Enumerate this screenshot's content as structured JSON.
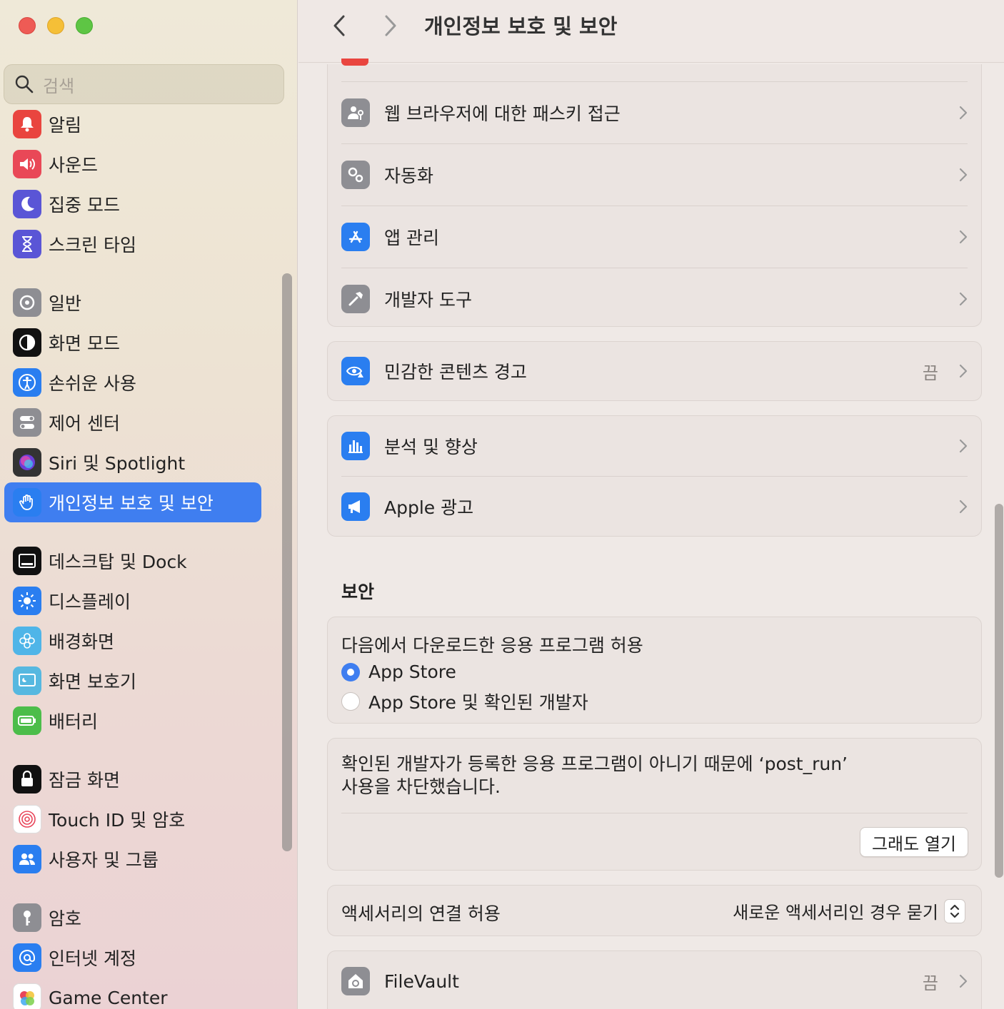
{
  "window": {
    "title": "개인정보 보호 및 보안"
  },
  "search": {
    "placeholder": "검색"
  },
  "sidebar": {
    "items": [
      {
        "label": "알림",
        "icon": "bell-icon",
        "color": "#e9453f"
      },
      {
        "label": "사운드",
        "icon": "speaker-icon",
        "color": "#e94857"
      },
      {
        "label": "집중 모드",
        "icon": "moon-icon",
        "color": "#5a55d6"
      },
      {
        "label": "스크린 타임",
        "icon": "hourglass-icon",
        "color": "#5a55d6"
      },
      {
        "label": "일반",
        "icon": "gear-icon",
        "color": "#8e8e93"
      },
      {
        "label": "화면 모드",
        "icon": "appearance-icon",
        "color": "#111111"
      },
      {
        "label": "손쉬운 사용",
        "icon": "accessibility-icon",
        "color": "#2a7ef0"
      },
      {
        "label": "제어 센터",
        "icon": "control-center-icon",
        "color": "#8e8e93"
      },
      {
        "label": "Siri 및 Spotlight",
        "icon": "siri-icon",
        "color": "#333333"
      },
      {
        "label": "개인정보 보호 및 보안",
        "icon": "hand-icon",
        "color": "#2a7ef0"
      },
      {
        "label": "데스크탑 및 Dock",
        "icon": "dock-icon",
        "color": "#111111"
      },
      {
        "label": "디스플레이",
        "icon": "sun-icon",
        "color": "#2a7ef0"
      },
      {
        "label": "배경화면",
        "icon": "flower-icon",
        "color": "#4fb5e8"
      },
      {
        "label": "화면 보호기",
        "icon": "screensaver-icon",
        "color": "#56b8e0"
      },
      {
        "label": "배터리",
        "icon": "battery-icon",
        "color": "#4cbd4a"
      },
      {
        "label": "잠금 화면",
        "icon": "lock-icon",
        "color": "#111111"
      },
      {
        "label": "Touch ID 및 암호",
        "icon": "fingerprint-icon",
        "color": "#ffffff"
      },
      {
        "label": "사용자 및 그룹",
        "icon": "users-icon",
        "color": "#2a7ef0"
      },
      {
        "label": "암호",
        "icon": "key-icon",
        "color": "#8e8e93"
      },
      {
        "label": "인터넷 계정",
        "icon": "at-icon",
        "color": "#2a7ef0"
      },
      {
        "label": "Game Center",
        "icon": "game-center-icon",
        "color": "#ffffff"
      }
    ],
    "active_index": 9
  },
  "main": {
    "group1": [
      {
        "label": "웹 브라우저에 대한 패스키 접근",
        "icon": "passkey-icon",
        "color": "#8e8e93"
      },
      {
        "label": "자동화",
        "icon": "automation-gears-icon",
        "color": "#8e8e93"
      },
      {
        "label": "앱 관리",
        "icon": "app-store-icon",
        "color": "#2a7ef0"
      },
      {
        "label": "개발자 도구",
        "icon": "hammer-icon",
        "color": "#8e8e93"
      }
    ],
    "sensitive": {
      "label": "민감한 콘텐츠 경고",
      "value": "끔",
      "icon": "eye-warning-icon",
      "color": "#2a7ef0"
    },
    "group2": [
      {
        "label": "분석 및 향상",
        "icon": "analytics-icon",
        "color": "#2a7ef0"
      },
      {
        "label": "Apple 광고",
        "icon": "megaphone-icon",
        "color": "#2a7ef0"
      }
    ],
    "security": {
      "title": "보안",
      "allow_heading": "다음에서 다운로드한 응용 프로그램 허용",
      "options": [
        {
          "label": "App Store",
          "selected": true
        },
        {
          "label": "App Store 및 확인된 개발자",
          "selected": false
        }
      ],
      "blocked_line1": "확인된 개발자가 등록한 응용 프로그램이 아니기 때문에 ‘post_run’",
      "blocked_line2": "사용을 차단했습니다.",
      "open_anyway": "그래도 열기",
      "accessory_label": "액세서리의 연결 허용",
      "accessory_value": "새로운 액세서리인 경우 묻기",
      "filevault_label": "FileVault",
      "filevault_value": "끔"
    }
  }
}
